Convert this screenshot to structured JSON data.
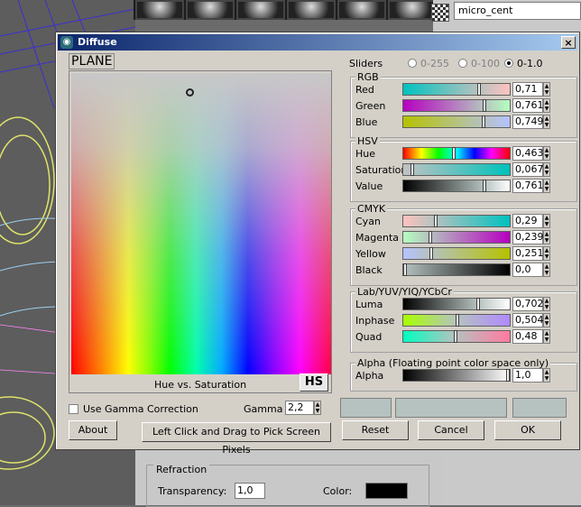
{
  "background": {
    "right_field": "micro_cent",
    "refraction": {
      "title": "Refraction",
      "transparency_label": "Transparency:",
      "transparency_value": "1,0",
      "color_label": "Color:"
    }
  },
  "dialog": {
    "title": "Diffuse",
    "close_label": "×",
    "plane_label": "PLANE",
    "picker_caption": "Hue vs. Saturation",
    "hs_button": "HS",
    "sliders_label": "Sliders",
    "range_options": [
      "0-255",
      "0-100",
      "0-1.0"
    ],
    "selected_range": "0-1.0",
    "groups": {
      "rgb": {
        "title": "RGB",
        "rows": [
          {
            "label": "Red",
            "value": "0,71",
            "fraction": 0.71
          },
          {
            "label": "Green",
            "value": "0,761",
            "fraction": 0.761
          },
          {
            "label": "Blue",
            "value": "0,749",
            "fraction": 0.749
          }
        ]
      },
      "hsv": {
        "title": "HSV",
        "rows": [
          {
            "label": "Hue",
            "value": "0,463",
            "fraction": 0.463
          },
          {
            "label": "Saturation",
            "value": "0,067",
            "fraction": 0.067
          },
          {
            "label": "Value",
            "value": "0,761",
            "fraction": 0.761
          }
        ]
      },
      "cmyk": {
        "title": "CMYK",
        "rows": [
          {
            "label": "Cyan",
            "value": "0,29",
            "fraction": 0.29
          },
          {
            "label": "Magenta",
            "value": "0,239",
            "fraction": 0.239
          },
          {
            "label": "Yellow",
            "value": "0,251",
            "fraction": 0.251
          },
          {
            "label": "Black",
            "value": "0,0",
            "fraction": 0.0
          }
        ]
      },
      "lab": {
        "title": "Lab/YUV/YIQ/YCbCr",
        "rows": [
          {
            "label": "Luma",
            "value": "0,702",
            "fraction": 0.702
          },
          {
            "label": "Inphase",
            "value": "0,504",
            "fraction": 0.504
          },
          {
            "label": "Quad",
            "value": "0,48",
            "fraction": 0.48
          }
        ]
      },
      "alpha": {
        "title": "Alpha (Floating point color space only)",
        "rows": [
          {
            "label": "Alpha",
            "value": "1,0",
            "fraction": 1.0
          }
        ]
      }
    },
    "use_gamma_label": "Use Gamma Correction",
    "gamma_label": "Gamma",
    "gamma_value": "2,2",
    "about_button": "About",
    "pick_button": "Left Click and Drag to Pick Screen Pixels",
    "reset_button": "Reset",
    "cancel_button": "Cancel",
    "ok_button": "OK"
  },
  "colors": {
    "current": "#b5c2bf"
  }
}
